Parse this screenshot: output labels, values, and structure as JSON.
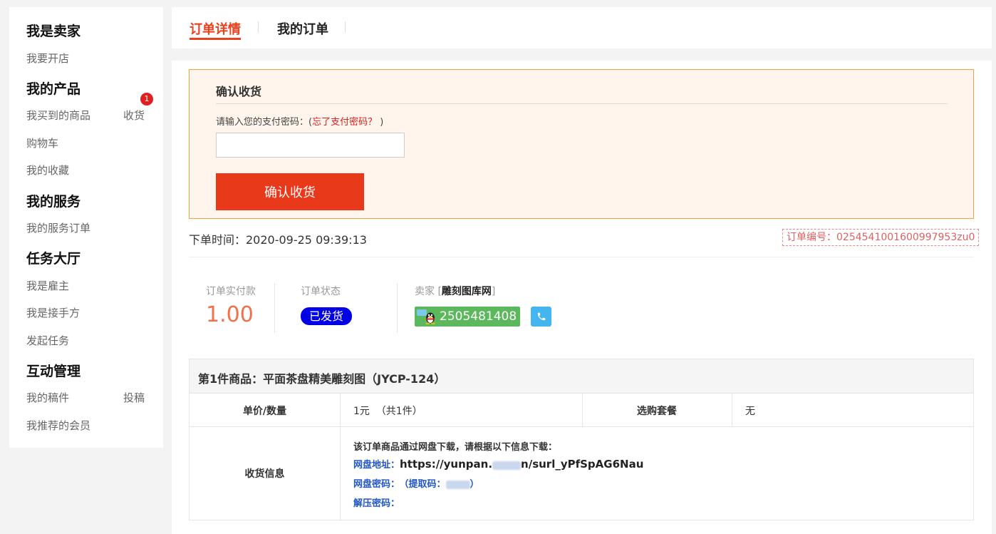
{
  "sidebar": {
    "seller_head": "我是卖家",
    "open_shop": "我要开店",
    "products_head": "我的产品",
    "bought": "我买到的商品",
    "receive": "收货",
    "receive_badge": "1",
    "cart": "购物车",
    "favorites": "我的收藏",
    "services_head": "我的服务",
    "service_orders": "我的服务订单",
    "task_head": "任务大厅",
    "employer": "我是雇主",
    "taker": "我是接手方",
    "start_task": "发起任务",
    "interact_head": "互动管理",
    "manuscripts": "我的稿件",
    "submit": "投稿",
    "recommended": "我推荐的会员"
  },
  "tabs": {
    "order_detail": "订单详情",
    "my_orders": "我的订单"
  },
  "confirm": {
    "title": "确认收货",
    "pw_prompt": "请输入您的支付密码：(",
    "forgot": "忘了支付密码？",
    "pw_suffix": " )",
    "pw_value": "",
    "button": "确认收货"
  },
  "order": {
    "time": "下单时间：2020-09-25 09:39:13",
    "number": "订单编号：0254541001600997953zu0",
    "paid_label": "订单实付款",
    "paid_amount": "1.00",
    "status_label": "订单状态",
    "status": "已发货",
    "seller_label": "卖家 [",
    "seller_name": "雕刻图库网",
    "seller_suffix": "]",
    "qq": "2505481408"
  },
  "product": {
    "title": "第1件商品：平面茶盘精美雕刻图（JYCP-124）",
    "price_qty_label": "单价/数量",
    "price_qty": "1元  （共1件）",
    "package_label": "选购套餐",
    "package": "无",
    "receive_label": "收货信息",
    "dl_intro": "该订单商品通过网盘下载，请根据以下信息下载：",
    "pan_url_label": "网盘地址：",
    "pan_url_a": "https://yunpan.",
    "pan_url_b": "n/surl_yPfSpAG6Nau",
    "pan_pw_label": "网盘密码：",
    "pan_pw_value": "（提取码：",
    "pan_pw_end": "）",
    "unzip_label": "解压密码："
  },
  "colors": {
    "accent": "#e8391a",
    "status_blue": "#0000e6",
    "qq_green": "#5cb85c",
    "phone_blue": "#45b5f0",
    "link_blue": "#2156c9"
  }
}
